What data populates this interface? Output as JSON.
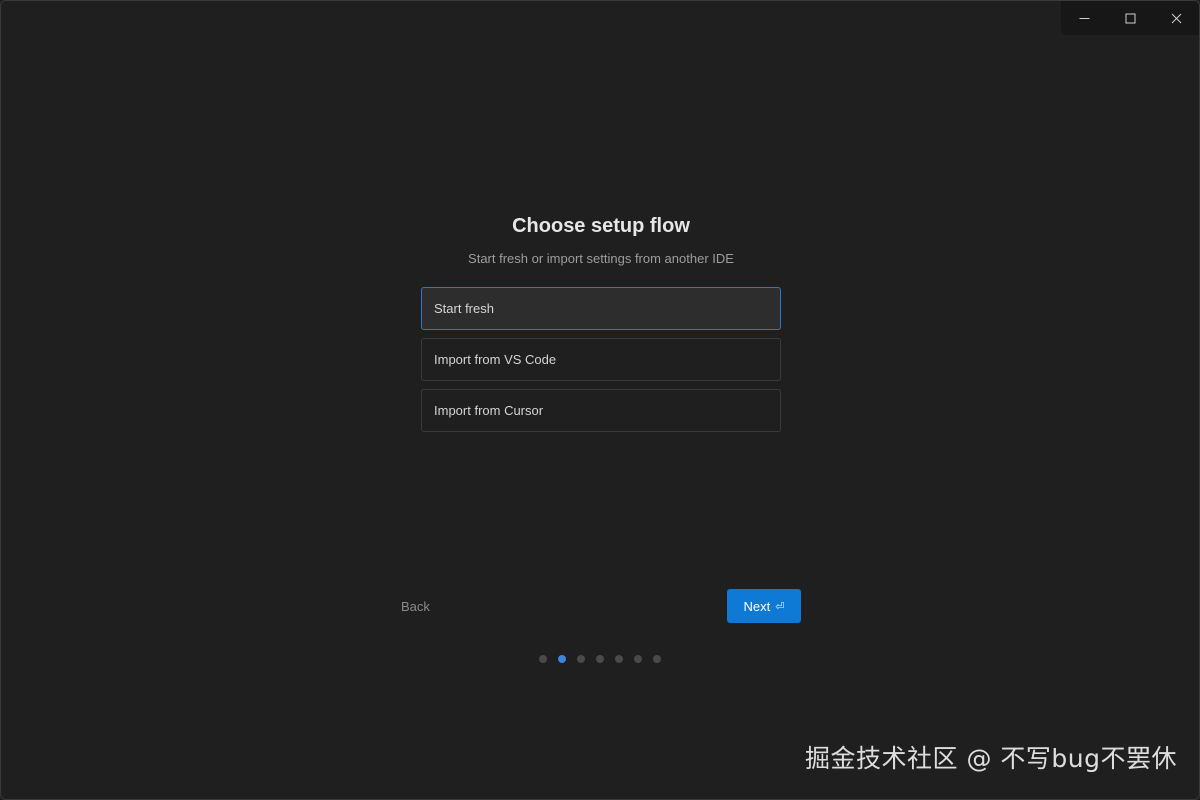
{
  "window_controls": {
    "minimize_icon": "minimize-icon",
    "maximize_icon": "maximize-icon",
    "close_icon": "close-icon"
  },
  "setup": {
    "title": "Choose setup flow",
    "subtitle": "Start fresh or import settings from another IDE",
    "options": [
      {
        "label": "Start fresh",
        "selected": true
      },
      {
        "label": "Import from VS Code",
        "selected": false
      },
      {
        "label": "Import from Cursor",
        "selected": false
      }
    ]
  },
  "navigation": {
    "back_label": "Back",
    "next_label": "Next",
    "next_glyph": "⏎",
    "steps_total": 7,
    "current_step": 2
  },
  "watermark": "掘金技术社区 @ 不写bug不罢休",
  "colors": {
    "background": "#1f1f1f",
    "accent": "#0e7ad6",
    "selected_border": "#2b79c2",
    "active_dot": "#3b86d6"
  }
}
